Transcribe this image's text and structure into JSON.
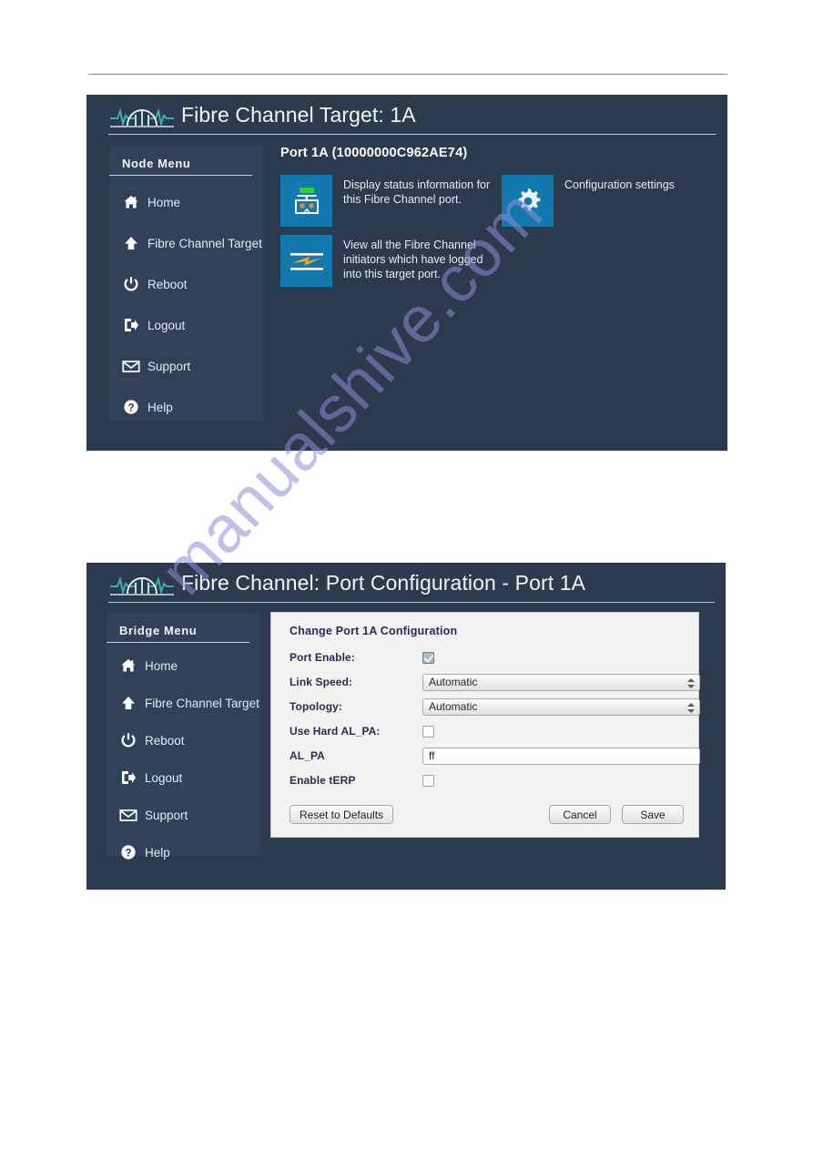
{
  "watermark": {
    "text": "manualshive.com"
  },
  "panels": [
    {
      "id": "fibre-channel-target",
      "title": "Fibre Channel Target: 1A",
      "menu": {
        "title": "Node Menu",
        "items": [
          {
            "label": "Home",
            "icon": "home-icon"
          },
          {
            "label": "Fibre Channel Target",
            "icon": "up-arrow-icon"
          },
          {
            "label": "Reboot",
            "icon": "power-icon"
          },
          {
            "label": "Logout",
            "icon": "logout-icon"
          },
          {
            "label": "Support",
            "icon": "envelope-icon"
          },
          {
            "label": "Help",
            "icon": "question-circle-icon"
          }
        ]
      },
      "content": {
        "heading": "Port 1A (10000000C962AE74)",
        "tiles": [
          {
            "icon": "port-status-icon",
            "text": "Display status information for this Fibre Channel port."
          },
          {
            "icon": "initiators-icon",
            "text": "View all the Fibre Channel initiators which have logged into this target port."
          },
          {
            "icon": "gear-icon",
            "text": "Configuration settings"
          }
        ]
      }
    },
    {
      "id": "port-configuration",
      "title": "Fibre Channel: Port Configuration - Port 1A",
      "menu": {
        "title": "Bridge Menu",
        "items": [
          {
            "label": "Home",
            "icon": "home-icon"
          },
          {
            "label": "Fibre Channel Target",
            "icon": "up-arrow-icon"
          },
          {
            "label": "Reboot",
            "icon": "power-icon"
          },
          {
            "label": "Logout",
            "icon": "logout-icon"
          },
          {
            "label": "Support",
            "icon": "envelope-icon"
          },
          {
            "label": "Help",
            "icon": "question-circle-icon"
          }
        ]
      },
      "form": {
        "title": "Change Port 1A Configuration",
        "fields": [
          {
            "label": "Port Enable:",
            "type": "checkbox",
            "checked": true
          },
          {
            "label": "Link Speed:",
            "type": "select",
            "value": "Automatic"
          },
          {
            "label": "Topology:",
            "type": "select",
            "value": "Automatic"
          },
          {
            "label": "Use Hard AL_PA:",
            "type": "checkbox",
            "checked": false
          },
          {
            "label": "AL_PA",
            "type": "text",
            "value": "ff"
          },
          {
            "label": "Enable tERP",
            "type": "checkbox",
            "checked": false
          }
        ],
        "buttons": {
          "reset": "Reset to Defaults",
          "cancel": "Cancel",
          "save": "Save"
        }
      }
    }
  ],
  "colors": {
    "panel_bg": "#2b3a4c",
    "menu_bg": "#31415a",
    "tile_blue": "#1278ad",
    "logo_teal": "#3fb0a8",
    "form_bg": "#f2f2f1",
    "watermark": "#8e8ed8"
  }
}
